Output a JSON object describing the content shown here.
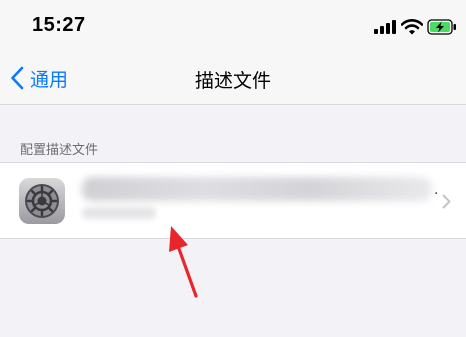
{
  "status_bar": {
    "time": "15:27",
    "icons": [
      "signal-icon",
      "wifi-icon",
      "battery-charging-icon"
    ],
    "battery_color": "#4cd964"
  },
  "nav": {
    "back_label": "通用",
    "title": "描述文件"
  },
  "section": {
    "header": "配置描述文件"
  },
  "profile": {
    "icon": "settings-gear-icon",
    "trailing_dot": "."
  },
  "colors": {
    "accent": "#0a7aff",
    "annotation": "#e8262c"
  }
}
